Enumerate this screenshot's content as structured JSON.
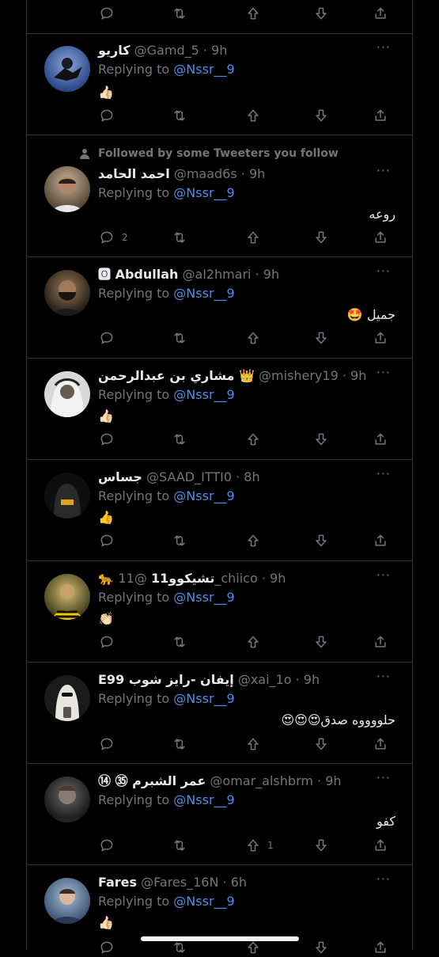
{
  "reply_prefix": "Replying to ",
  "more_label": "···",
  "top_actions": {
    "reply": "",
    "retweet": "",
    "like": "",
    "down": "",
    "share": ""
  },
  "social_context": "Followed by some Tweeters you follow",
  "tweets": [
    {
      "name": "كاريو",
      "handle": "@Gamd_5",
      "time": "9h",
      "mention": "@Nssr__9",
      "text": "👍🏻",
      "reply_count": "",
      "like_count": ""
    },
    {
      "name": "احمد الحامد",
      "handle": "@maad6s",
      "time": "9h",
      "mention": "@Nssr__9",
      "text": "روعه",
      "reply_count": "2",
      "like_count": ""
    },
    {
      "name": "🅾 Abdullah",
      "handle": "@al2hmari",
      "time": "9h",
      "mention": "@Nssr__9",
      "text": "جميل 🤩",
      "reply_count": "",
      "like_count": ""
    },
    {
      "name": "مشاري بن عبدالرحمن 👑",
      "handle": "@mishery19",
      "time": "9h",
      "mention": "@Nssr__9",
      "text": "👍🏻",
      "reply_count": "",
      "like_count": ""
    },
    {
      "name": "جساس",
      "handle": "@SAAD_ITTI0",
      "time": "8h",
      "mention": "@Nssr__9",
      "text": "👍",
      "reply_count": "",
      "like_count": ""
    },
    {
      "name": "🐆 تشيكوو11",
      "handle": "@11_chiico",
      "time": "9h",
      "mention": "@Nssr__9",
      "text": "👏🏻",
      "reply_count": "",
      "like_count": ""
    },
    {
      "name": "E99 إيفان -رايز شوب",
      "handle": "@xai_1o",
      "time": "9h",
      "mention": "@Nssr__9",
      "text": "حلووووه صدق😍😍😍",
      "reply_count": "",
      "like_count": ""
    },
    {
      "name": "⑭ ㉟ عمر الشبرم",
      "handle": "@omar_alshbrm",
      "time": "9h",
      "mention": "@Nssr__9",
      "text": "كفو",
      "reply_count": "",
      "like_count": "1"
    },
    {
      "name": "Fares",
      "handle": "@Fares_16N",
      "time": "6h",
      "mention": "@Nssr__9",
      "text": "👍🏻",
      "reply_count": "",
      "like_count": ""
    }
  ]
}
